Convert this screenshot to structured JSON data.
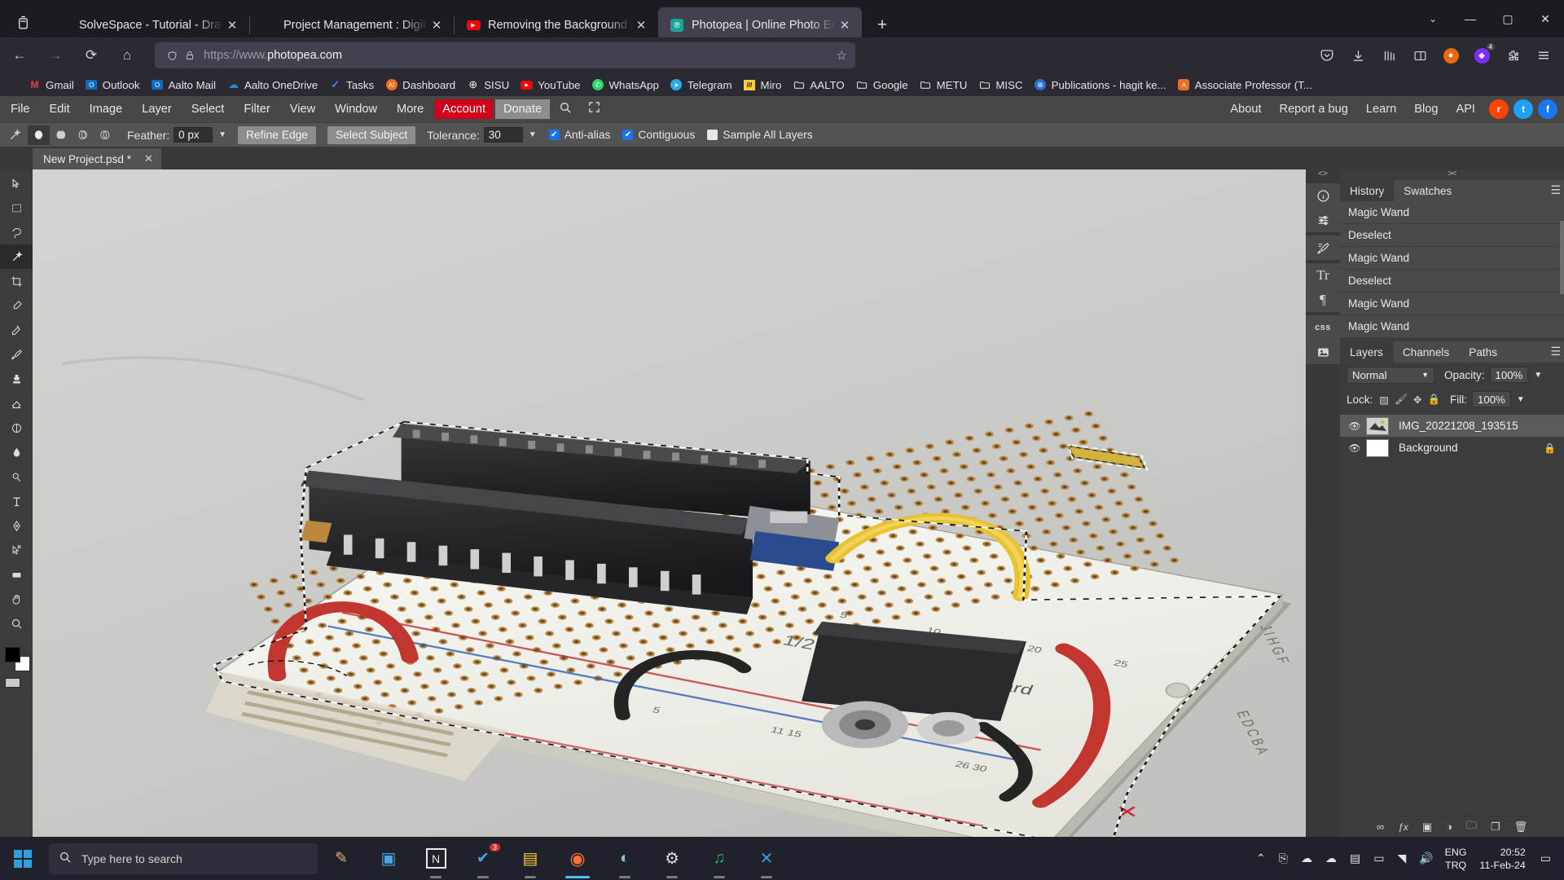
{
  "browser": {
    "tabs": [
      {
        "title": "SolveSpace - Tutorial - Drawing an",
        "favicon": "none",
        "close": "✕",
        "active": false
      },
      {
        "title": "Project Management : Digital Fabric",
        "favicon": "none",
        "close": "✕",
        "active": false
      },
      {
        "title": "Removing the Background from",
        "favicon": "youtube-icon",
        "close": "✕",
        "active": false
      },
      {
        "title": "Photopea | Online Photo Editor",
        "favicon": "photopea-icon",
        "close": "✕",
        "active": true
      }
    ],
    "newtab_label": "+",
    "window_controls": {
      "list_all": "⌄",
      "minimize": "—",
      "maximize": "▢",
      "close": "✕"
    },
    "nav": {
      "back": "←",
      "forward": "→",
      "reload": "⟳",
      "home": "⌂"
    },
    "url": {
      "prefix": "https://www.",
      "domain": "photopea.com",
      "shield": "shield-icon",
      "lock": "lock-icon",
      "star": "☆"
    },
    "nav_right_icons": [
      "pocket-icon",
      "download-icon",
      "library-icon",
      "reader-icon",
      "account-icon",
      "extension-badge-icon",
      "extensions-icon",
      "menu-icon"
    ],
    "extension_badge_count": "4",
    "bookmarks": [
      {
        "label": "Gmail",
        "icon": "M",
        "color": "#ea4335",
        "bg": "#ffffff"
      },
      {
        "label": "Outlook",
        "icon": "O",
        "color": "#ffffff",
        "bg": "#0f6cbd"
      },
      {
        "label": "Aalto Mail",
        "icon": "O",
        "color": "#ffffff",
        "bg": "#0f6cbd"
      },
      {
        "label": "Aalto OneDrive",
        "icon": "☁",
        "color": "#ffffff",
        "bg": "#1a8fd6"
      },
      {
        "label": "Tasks",
        "icon": "✓",
        "color": "#ffffff",
        "bg": "#3b82f6"
      },
      {
        "label": "Dashboard",
        "icon": "A!",
        "color": "#ffffff",
        "bg": "#ef6c23"
      },
      {
        "label": "SISU",
        "icon": "⊕",
        "color": "#ffffff",
        "bg": "transparent"
      },
      {
        "label": "YouTube",
        "icon": "▶",
        "color": "#ffffff",
        "bg": "#ff0000"
      },
      {
        "label": "WhatsApp",
        "icon": "✆",
        "color": "#ffffff",
        "bg": "#25d366"
      },
      {
        "label": "Telegram",
        "icon": "➤",
        "color": "#ffffff",
        "bg": "#2aabee"
      },
      {
        "label": "Miro",
        "icon": "///",
        "color": "#050038",
        "bg": "#ffd02f"
      },
      {
        "label": "AALTO",
        "icon": "folder",
        "color": "#d8d8d8",
        "bg": "transparent"
      },
      {
        "label": "Google",
        "icon": "folder",
        "color": "#d8d8d8",
        "bg": "transparent"
      },
      {
        "label": "METU",
        "icon": "folder",
        "color": "#d8d8d8",
        "bg": "transparent"
      },
      {
        "label": "MISC",
        "icon": "folder",
        "color": "#d8d8d8",
        "bg": "transparent"
      },
      {
        "label": "Publications - hagit ke...",
        "icon": "⊕",
        "color": "#ffffff",
        "bg": "#2a6fd6"
      },
      {
        "label": "Associate Professor (T...",
        "icon": "A",
        "color": "#ffffff",
        "bg": "#ef6c23"
      }
    ]
  },
  "photopea": {
    "menu": [
      "File",
      "Edit",
      "Image",
      "Layer",
      "Select",
      "Filter",
      "View",
      "Window",
      "More"
    ],
    "account_label": "Account",
    "donate_label": "Donate",
    "search_icon": "search-icon",
    "fullscreen_icon": "fullscreen-icon",
    "menu_right": [
      "About",
      "Report a bug",
      "Learn",
      "Blog",
      "API"
    ],
    "social": [
      {
        "name": "reddit-icon",
        "glyph": "r",
        "color": "#ff4500"
      },
      {
        "name": "twitter-icon",
        "glyph": "t",
        "color": "#1da1f2"
      },
      {
        "name": "facebook-icon",
        "glyph": "f",
        "color": "#1877f2"
      }
    ],
    "options": {
      "tool_icon": "magic-wand-icon",
      "selection_modes": [
        "new-selection",
        "add-to-selection",
        "subtract-from-selection",
        "intersect-selection"
      ],
      "active_mode_index": 0,
      "feather_label": "Feather:",
      "feather_value": "0 px",
      "refine_edge_label": "Refine Edge",
      "select_subject_label": "Select Subject",
      "tolerance_label": "Tolerance:",
      "tolerance_value": "30",
      "antialias_label": "Anti-alias",
      "antialias_checked": true,
      "contiguous_label": "Contiguous",
      "contiguous_checked": true,
      "sample_all_label": "Sample All Layers",
      "sample_all_checked": false
    },
    "document_tab": {
      "name": "New Project.psd *",
      "close": "✕"
    },
    "tools": [
      "move-tool",
      "rectangular-marquee-tool",
      "lasso-tool",
      "magic-wand-tool",
      "crop-tool",
      "eyedropper-tool",
      "healing-brush-tool",
      "brush-tool",
      "stamp-tool",
      "eraser-tool",
      "gradient-tool",
      "blur-tool",
      "dodge-tool",
      "type-tool",
      "pen-tool",
      "path-selection-tool",
      "shape-tool",
      "hand-tool",
      "zoom-tool"
    ],
    "active_tool_index": 3,
    "dock_icons": [
      "info-icon",
      "adjustments-icon",
      "brush-settings-icon",
      "character-icon",
      "paragraph-icon",
      "css-icon",
      "image-icon"
    ],
    "panels": {
      "history": {
        "collapse_glyph": "<>",
        "tabs": [
          {
            "label": "History",
            "active": true
          },
          {
            "label": "Swatches",
            "active": false
          }
        ],
        "menu_icon": "panel-menu-icon",
        "items": [
          "Magic Wand",
          "Deselect",
          "Magic Wand",
          "Deselect",
          "Magic Wand",
          "Magic Wand"
        ]
      },
      "layers": {
        "collapse_glyph": "><",
        "tabs": [
          {
            "label": "Layers",
            "active": true
          },
          {
            "label": "Channels",
            "active": false
          },
          {
            "label": "Paths",
            "active": false
          }
        ],
        "menu_icon": "panel-menu-icon",
        "blend_mode": "Normal",
        "opacity_label": "Opacity:",
        "opacity_value": "100%",
        "lock_label": "Lock:",
        "lock_icons": [
          "lock-transparency-icon",
          "lock-paint-icon",
          "lock-position-icon",
          "lock-all-icon"
        ],
        "fill_label": "Fill:",
        "fill_value": "100%",
        "caret": "▼",
        "items": [
          {
            "name": "IMG_20221208_193515",
            "visible": true,
            "selected": true,
            "locked": false,
            "thumb": "photo-thumb"
          },
          {
            "name": "Background",
            "visible": true,
            "selected": false,
            "locked": true,
            "thumb": "white-thumb"
          }
        ],
        "bottom_icons": [
          "link-layers-icon",
          "fx-icon",
          "mask-icon",
          "adjustment-layer-icon",
          "new-group-icon",
          "new-layer-icon",
          "delete-layer-icon"
        ]
      }
    }
  },
  "taskbar": {
    "start_icon": "windows-start-icon",
    "search_placeholder": "Type here to search",
    "search_icon": "search-icon",
    "apps": [
      {
        "name": "cortana-icon",
        "glyph": "✎",
        "running": false
      },
      {
        "name": "store-icon",
        "glyph": "▣",
        "running": false
      },
      {
        "name": "notion-icon",
        "glyph": "N",
        "running": true
      },
      {
        "name": "teams-icon",
        "glyph": "✔",
        "running": true,
        "badge": "3"
      },
      {
        "name": "file-explorer-icon",
        "glyph": "▤",
        "running": true
      },
      {
        "name": "firefox-icon",
        "glyph": "◉",
        "running": true,
        "active": true
      },
      {
        "name": "photopea-icon",
        "glyph": "◐",
        "running": true
      },
      {
        "name": "settings-icon",
        "glyph": "⚙",
        "running": true
      },
      {
        "name": "spotify-icon",
        "glyph": "♫",
        "running": true
      },
      {
        "name": "vscode-icon",
        "glyph": "✕",
        "running": true
      }
    ],
    "tray": {
      "chevron": "⌃",
      "icons": [
        "bluetooth-icon",
        "onedrive-icon",
        "cloud-icon",
        "usb-icon",
        "screen-icon",
        "wifi-icon",
        "volume-icon"
      ],
      "language_top": "ENG",
      "language_bottom": "TRQ",
      "time": "20:52",
      "date": "11-Feb-24",
      "notification_icon": "notification-icon"
    }
  }
}
